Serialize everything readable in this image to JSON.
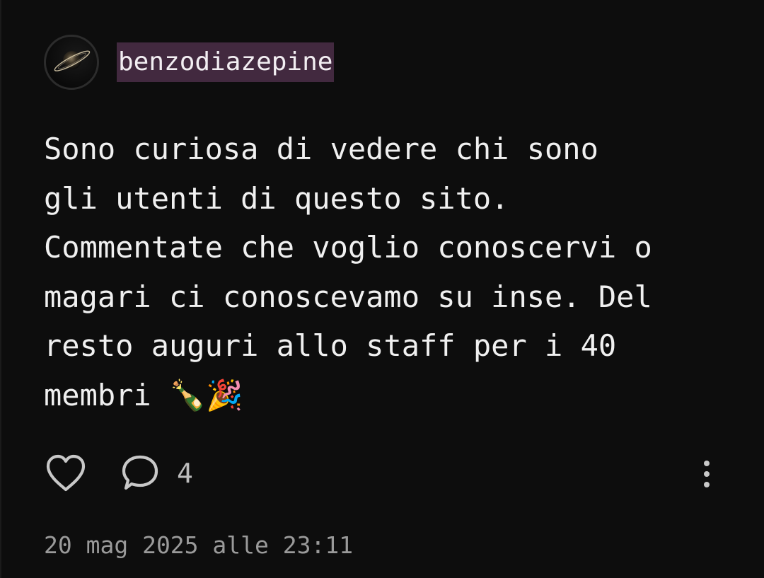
{
  "post": {
    "author": {
      "username": "benzodiazepine",
      "avatar_icon": "saturn-planet-avatar"
    },
    "content": "Sono curiosa di vedere chi sono\ngli utenti di questo sito.\nCommentate che voglio conoscervi o\nmagari ci conoscevamo su inse. Del\nresto auguri allo staff per i 40\nmembri 🍾🎉",
    "actions": {
      "like_icon": "heart-outline-icon",
      "comment_icon": "speech-bubble-icon",
      "comment_count": "4",
      "more_icon": "vertical-dots-icon"
    },
    "timestamp": "20 mag 2025 alle 23:11"
  },
  "colors": {
    "background": "#0d0d0d",
    "username_highlight": "#42293f",
    "text": "#f0f0f0",
    "muted": "#9a9a9a",
    "icon": "#c8c8c8"
  }
}
